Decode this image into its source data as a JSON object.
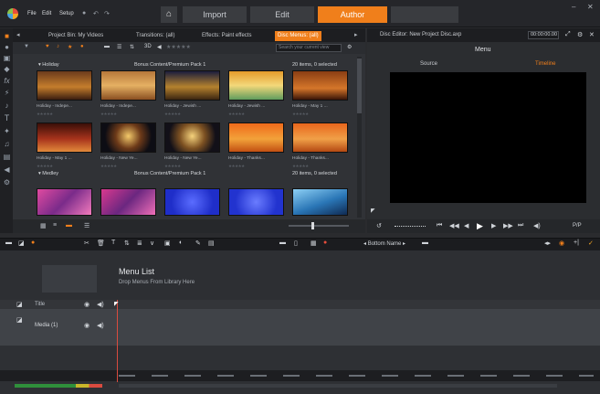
{
  "menubar": {
    "items": [
      "File",
      "Edit",
      "Setup"
    ],
    "modes": [
      "Import",
      "Edit",
      "Author",
      ""
    ]
  },
  "library": {
    "tabs": [
      "Project Bin: My Videos",
      "Transitions: (all)",
      "Effects: Paint effects",
      "Disc Menus: (all)"
    ],
    "toolbar_items": [
      "3D"
    ],
    "search_placeholder": "Search your current view",
    "groups": [
      {
        "name": "Holiday",
        "source": "Bonus Content/Premium Pack 1",
        "status": "20 items, 0 selected",
        "rows": [
          [
            "Holiday - Indepe...",
            "Holiday - Indepe...",
            "Holiday - Jewish ...",
            "Holiday - Jewish ...",
            "Holiday - May 1 ..."
          ],
          [
            "Holiday - May 1 ...",
            "Holiday - New Ye...",
            "Holiday - New Ye...",
            "Holiday - Thanks...",
            "Holiday - Thanks..."
          ]
        ]
      },
      {
        "name": "Medley",
        "source": "Bonus Content/Premium Pack 1",
        "status": "20 items, 0 selected"
      }
    ]
  },
  "editor": {
    "title": "Disc Editor: New Project Disc.axp",
    "timecode": "00:00:00.00",
    "panel_label": "Menu",
    "tabs": [
      "Source",
      "Timeline"
    ],
    "end_label": "P/P"
  },
  "timeline": {
    "toolbar_label": "Bottom Name",
    "menu_list_title": "Menu List",
    "menu_list_hint": "Drop Menus From Library Here",
    "track_title": "Title",
    "track_media": "Media (1)"
  }
}
